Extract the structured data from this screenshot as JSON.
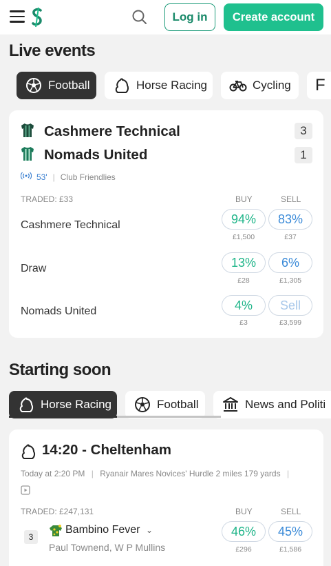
{
  "header": {
    "login_label": "Log in",
    "create_label": "Create account"
  },
  "live": {
    "title": "Live events",
    "tabs": [
      {
        "label": "Football",
        "icon": "football-icon",
        "active": true
      },
      {
        "label": "Horse Racing",
        "icon": "horse-icon",
        "active": false
      },
      {
        "label": "Cycling",
        "icon": "bicycle-icon",
        "active": false
      },
      {
        "label": "F",
        "icon": "",
        "active": false
      }
    ],
    "match": {
      "home": {
        "name": "Cashmere Technical",
        "score": "3"
      },
      "away": {
        "name": "Nomads United",
        "score": "1"
      },
      "minute": "53'",
      "competition": "Club Friendlies",
      "traded": "TRADED: £33",
      "buy_label": "BUY",
      "sell_label": "SELL",
      "selections": [
        {
          "name": "Cashmere Technical",
          "buy": "94%",
          "buy_vol": "£1,500",
          "sell": "83%",
          "sell_vol": "£37"
        },
        {
          "name": "Draw",
          "buy": "13%",
          "buy_vol": "£28",
          "sell": "6%",
          "sell_vol": "£1,305"
        },
        {
          "name": "Nomads United",
          "buy": "4%",
          "buy_vol": "£3",
          "sell": "Sell",
          "sell_vol": "£3,599"
        }
      ]
    }
  },
  "soon": {
    "title": "Starting soon",
    "tabs": [
      {
        "label": "Horse Racing",
        "icon": "horse-icon",
        "active": true
      },
      {
        "label": "Football",
        "icon": "football-icon",
        "active": false
      },
      {
        "label": "News and Politi",
        "icon": "bank-icon",
        "active": false
      }
    ],
    "race": {
      "title": "14:20 - Cheltenham",
      "time": "Today at 2:20 PM",
      "description": "Ryanair Mares Novices' Hurdle 2 miles 179 yards",
      "traded": "TRADED: £247,131",
      "buy_label": "BUY",
      "sell_label": "SELL",
      "runner": {
        "number": "3",
        "name": "Bambino Fever",
        "jockey": "Paul Townend, W P Mullins",
        "buy": "46%",
        "buy_vol": "£296",
        "sell": "45%",
        "sell_vol": "£1,586"
      }
    }
  },
  "colors": {
    "accent": "#1fc08e",
    "buy": "#1fb589",
    "sell": "#3a8ad8"
  }
}
